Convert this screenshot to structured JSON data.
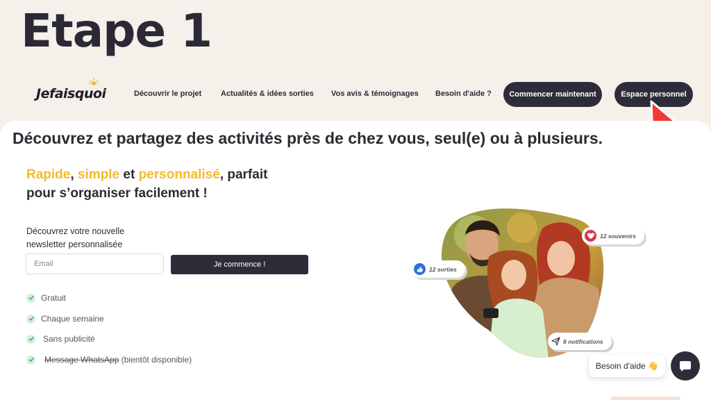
{
  "overlay": {
    "step_title": "Etape 1"
  },
  "nav": {
    "logo": "Jefaisquoi",
    "links": [
      "Découvrir le projet",
      "Actualités & idées sorties",
      "Vos avis & témoignages",
      "Besoin d'aide ?"
    ],
    "cta_start": "Commencer maintenant",
    "cta_account": "Espace personnel"
  },
  "hero": {
    "headline": "Découvrez et partagez des activités près de chez vous, seul(e) ou à plusieurs.",
    "sub_word1": "Rapide",
    "sub_sep1": ", ",
    "sub_word2": "simple",
    "sub_sep2": " et ",
    "sub_word3": "personnalisé",
    "sub_rest1": ", parfait",
    "sub_rest2": "pour s’organiser facilement !",
    "accent_color": "#f5b92a"
  },
  "newsletter": {
    "label_line1": "Découvrez votre nouvelle",
    "label_line2": "newsletter personnalisée",
    "email_placeholder": "Email",
    "submit_label": "Je commence !"
  },
  "features": [
    {
      "text": "Gratuit"
    },
    {
      "text": "Chaque semaine"
    },
    {
      "text": "Sans publicité"
    },
    {
      "text": "Message WhatsApp",
      "suffix": "(bientôt disponible)"
    }
  ],
  "badges": {
    "sorties": "12 sorties",
    "souvenirs": "12 souvenirs",
    "notifications": "8 notifications"
  },
  "help": {
    "label": "Besoin d'aide 👋"
  }
}
